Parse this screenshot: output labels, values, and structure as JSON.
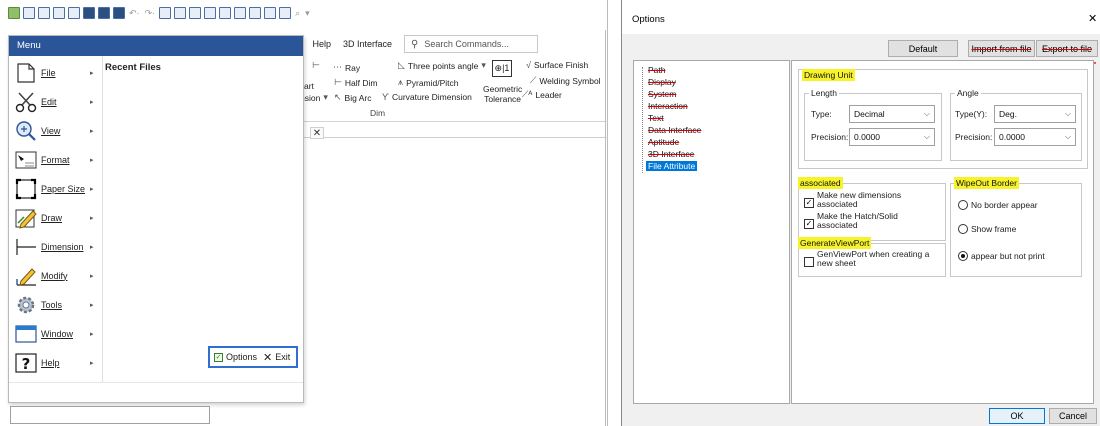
{
  "app": {
    "quick_access": [
      "new-icon",
      "open-icon",
      "save-icon",
      "saveas-icon",
      "print-icon",
      "undo-icon",
      "redo-icon"
    ],
    "ribbon_tabs": [
      "Help",
      "3D Interface"
    ],
    "search_placeholder": "Search Commands...",
    "ribbon": {
      "ray": "Ray",
      "three_points_angle": "Three points angle",
      "surface_finish": "Surface Finish",
      "half_dim": "Half Dim",
      "pyramid_pitch": "Pyramid/Pitch",
      "welding_symbol": "Welding Symbol",
      "big_arc": "Big Arc",
      "curvature_dimension": "Curvature Dimension",
      "geometric": "Geometric",
      "tolerance": "Tolerance",
      "leader": "Leader",
      "partial_1": "art",
      "partial_2": "nsion",
      "group_label": "Dim"
    },
    "menu": {
      "title": "Menu",
      "items": [
        {
          "label": "File"
        },
        {
          "label": "Edit"
        },
        {
          "label": "View"
        },
        {
          "label": "Format"
        },
        {
          "label": "Paper Size"
        },
        {
          "label": "Draw"
        },
        {
          "label": "Dimension"
        },
        {
          "label": "Modify"
        },
        {
          "label": "Tools"
        },
        {
          "label": "Window"
        },
        {
          "label": "Help"
        }
      ],
      "recent_files_title": "Recent Files",
      "options_label": "Options",
      "exit_label": "Exit"
    }
  },
  "dialog": {
    "title": "Options",
    "buttons": {
      "default": "Default",
      "import": "Import from file",
      "export": "Export to file",
      "ok": "OK",
      "cancel": "Cancel"
    },
    "tree": [
      {
        "label": "Path",
        "struck": true
      },
      {
        "label": "Display",
        "struck": true
      },
      {
        "label": "System",
        "struck": true
      },
      {
        "label": "Interaction",
        "struck": true
      },
      {
        "label": "Text",
        "struck": true
      },
      {
        "label": "Data Interface",
        "struck": true
      },
      {
        "label": "Aptitude",
        "struck": true
      },
      {
        "label": "3D Interface",
        "struck": true
      },
      {
        "label": "File Attribute",
        "selected": true
      }
    ],
    "drawing_unit": {
      "title": "Drawing Unit",
      "length": {
        "title": "Length",
        "type_label": "Type:",
        "type_value": "Decimal",
        "precision_label": "Precision:",
        "precision_value": "0.0000"
      },
      "angle": {
        "title": "Angle",
        "type_label": "Type(Y):",
        "type_value": "Deg.",
        "precision_label": "Precision:",
        "precision_value": "0.0000"
      }
    },
    "associated": {
      "title": "associated",
      "opt1": "Make new dimensions associated",
      "opt1_checked": true,
      "opt2": "Make the Hatch/Solid associated",
      "opt2_checked": true
    },
    "generate_viewport": {
      "title": "GenerateViewPort",
      "opt": "GenViewPort when creating a new sheet",
      "opt_checked": false
    },
    "wipeout_border": {
      "title": "WipeOut Border",
      "opt1": "No border appear",
      "opt2": "Show frame",
      "opt3": "appear but not print",
      "selected": "appear but not print"
    },
    "highlight_color": "#f7f32a",
    "strike_color": "#dd0000",
    "selection_color": "#0078d7"
  }
}
